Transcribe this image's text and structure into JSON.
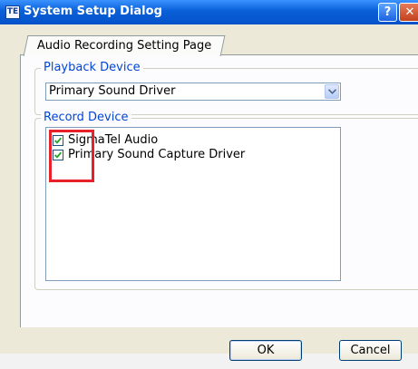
{
  "window": {
    "title": "System Setup Dialog",
    "icon": "app-icon",
    "help_label": "?",
    "close_label": "✕"
  },
  "tab": {
    "label": "Audio Recording Setting Page"
  },
  "playback": {
    "legend": "Playback Device",
    "selected": "Primary Sound Driver"
  },
  "record": {
    "legend": "Record Device",
    "items": [
      {
        "label": "SigmaTel Audio",
        "checked": true
      },
      {
        "label": "Primary Sound Capture Driver",
        "checked": true
      }
    ]
  },
  "buttons": {
    "ok": "OK",
    "cancel": "Cancel"
  },
  "colors": {
    "titlebar": "#0a5fd8",
    "legend_text": "#0046d5",
    "highlight": "#e8202a",
    "check": "#21a121"
  }
}
